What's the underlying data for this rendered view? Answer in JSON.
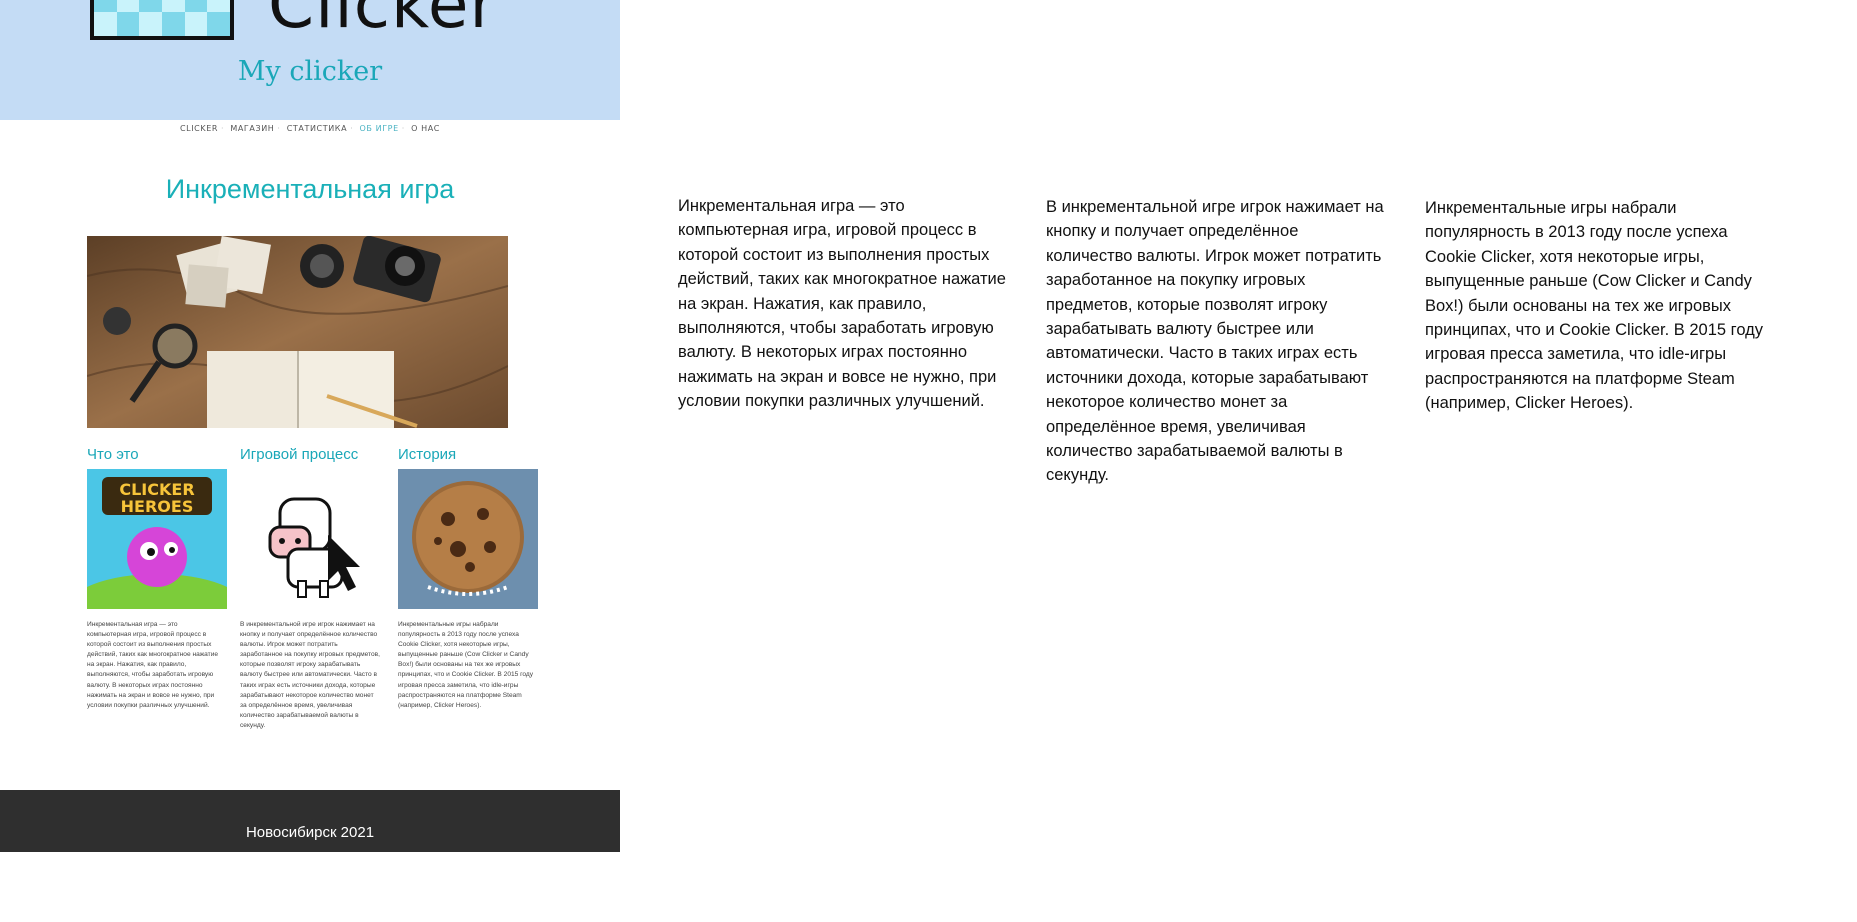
{
  "header": {
    "logo_text": "Clicker",
    "subtitle": "My clicker"
  },
  "nav": {
    "items": [
      "CLICKER",
      "МАГАЗИН",
      "СТАТИСТИКА",
      "ОБ ИГРЕ",
      "О НАС"
    ],
    "active_index": 3
  },
  "page": {
    "title": "Инкрементальная игра"
  },
  "columns": [
    {
      "heading": "Что это",
      "image": "clicker-heroes-icon"
    },
    {
      "heading": "Игровой процесс",
      "image": "cow-clicker-icon"
    },
    {
      "heading": "История",
      "image": "cookie-clicker-icon"
    }
  ],
  "texts": {
    "what": "Инкрементальная игра  — это компьютерная игра, игровой процесс в которой состоит из выполнения простых действий, таких как многократное нажатие на экран. Нажатия, как правило, выполняются, чтобы заработать игровую валюту. В некоторых играх постоянно нажимать на экран и вовсе не нужно, при условии покупки различных улучшений.",
    "gameplay": "В инкрементальной игре игрок нажимает на кнопку и получает определённое количество валюты. Игрок может потратить заработанное на покупку игровых предметов, которые позволят игроку зарабатывать валюту быстрее или автоматически. Часто в таких играх есть источники дохода, которые зарабатывают некоторое количество монет за определённое время, увеличивая количество зарабатываемой валюты в секунду.",
    "history": "Инкрементальные игры набрали популярность в 2013 году после успеха Cookie Clicker, хотя некоторые игры, выпущенные раньше (Cow Clicker и Candy Box!) были основаны на тех же игровых принципах, что и Cookie Clicker. В 2015 году игровая пресса заметила, что idle-игры распространяются на платформе Steam (например, Clicker Heroes)."
  },
  "footer": {
    "text": "Новосибирск 2021"
  },
  "colors": {
    "hero_bg": "#c4dcf5",
    "accent": "#1aa7b8",
    "footer_bg": "#2f2f2f"
  }
}
